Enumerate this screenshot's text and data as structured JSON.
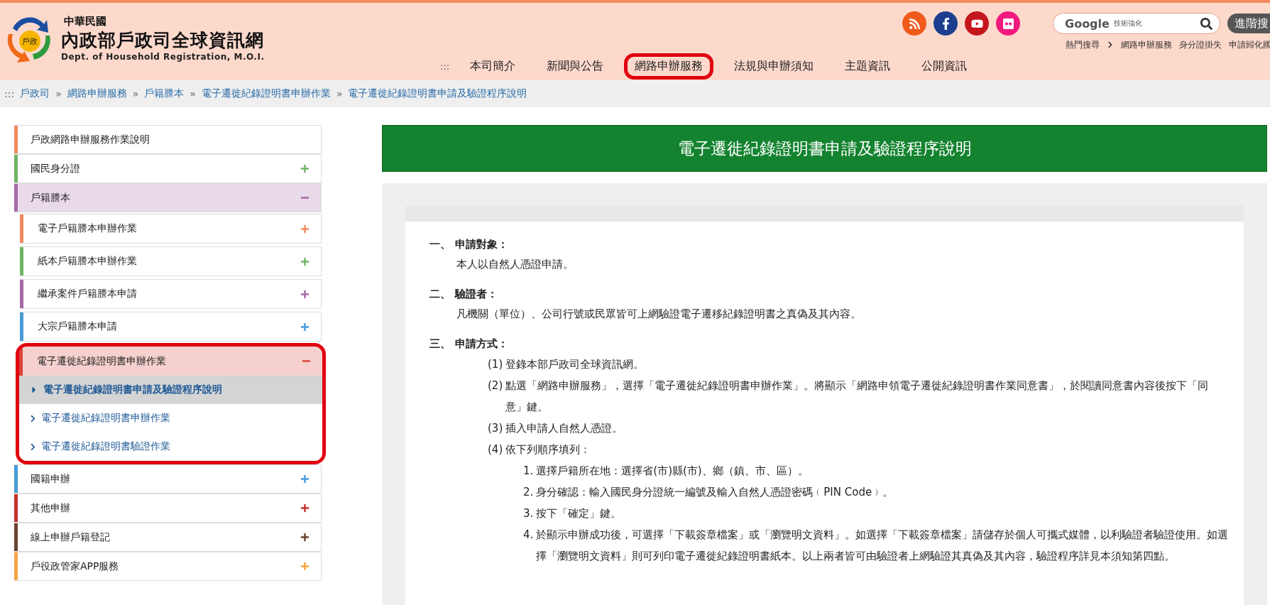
{
  "header": {
    "logo": {
      "center": "戶政"
    },
    "country": "中華民國",
    "site_title": "內政部戶政司全球資訊網",
    "site_subtitle": "Dept. of Household Registration, M.O.I.",
    "social": [
      {
        "kind": "rss",
        "color": "#f05a1a"
      },
      {
        "kind": "facebook",
        "color": "#1d3d8f"
      },
      {
        "kind": "youtube",
        "color": "#c4161c"
      },
      {
        "kind": "flickr",
        "color": "#f0197d"
      }
    ],
    "search": {
      "brand": "Google",
      "brand_note": "技術強化",
      "button": "進階搜"
    },
    "hot_search": {
      "label": "熱門搜尋",
      "links": [
        "網路申辦服務",
        "身分證掛失",
        "申請歸化國"
      ]
    },
    "nav_prefix": ":::",
    "nav": [
      {
        "label": "本司簡介",
        "annotated": false
      },
      {
        "label": "新聞與公告",
        "annotated": false
      },
      {
        "label": "網路申辦服務",
        "annotated": true
      },
      {
        "label": "法規與申辦須知",
        "annotated": false
      },
      {
        "label": "主題資訊",
        "annotated": false
      },
      {
        "label": "公開資訊",
        "annotated": false
      }
    ]
  },
  "breadcrumb": {
    "prefix": ":::",
    "separator": "»",
    "items": [
      "戶政司",
      "網路申辦服務",
      "戶籍謄本",
      "電子遷徙紀錄證明書申辦作業",
      "電子遷徙紀錄證明書申請及驗證程序說明"
    ]
  },
  "sidebar": [
    {
      "label": "戶政網路申辦服務作業說明",
      "color": "#f08a5d",
      "kind": "plain"
    },
    {
      "label": "國民身分證",
      "color": "#6fb464",
      "kind": "group",
      "expanded": false
    },
    {
      "label": "戶籍謄本",
      "color": "#a66aa6",
      "kind": "group",
      "expanded": true,
      "children": [
        {
          "label": "電子戶籍謄本申辦作業",
          "color": "#f08a5d",
          "kind": "group",
          "expanded": false
        },
        {
          "label": "紙本戶籍謄本申辦作業",
          "color": "#6fb464",
          "kind": "group",
          "expanded": false
        },
        {
          "label": "繼承案件戶籍謄本申請",
          "color": "#a66aa6",
          "kind": "group",
          "expanded": false
        },
        {
          "label": "大宗戶籍謄本申請",
          "color": "#4a9ad6",
          "kind": "group",
          "expanded": false
        },
        {
          "label": "電子遷徙紀錄證明書申辦作業",
          "color": "#d9453a",
          "kind": "group",
          "expanded": true,
          "annotated": true,
          "children": [
            {
              "label": "電子遷徙紀錄證明書申請及驗證程序說明",
              "selected": true
            },
            {
              "label": "電子遷徙紀錄證明書申辦作業",
              "selected": false
            },
            {
              "label": "電子遷徙紀錄證明書驗證作業",
              "selected": false
            }
          ]
        }
      ]
    },
    {
      "label": "國籍申辦",
      "color": "#4a9ad6",
      "kind": "group",
      "expanded": false
    },
    {
      "label": "其他申辦",
      "color": "#c7302b",
      "kind": "group",
      "expanded": false
    },
    {
      "label": "線上申辦戶籍登記",
      "color": "#6b4330",
      "kind": "group",
      "expanded": false
    },
    {
      "label": "戶役政管家APP服務",
      "color": "#f5a442",
      "kind": "group",
      "expanded": false
    }
  ],
  "page_title": "電子遷徙紀錄證明書申請及驗證程序說明",
  "sections": [
    {
      "number": "一、",
      "title": "申請對象：",
      "body": "本人以自然人憑證申請。"
    },
    {
      "number": "二、",
      "title": "驗證者：",
      "body": "凡機關（單位）、公司行號或民眾皆可上網驗證電子遷移紀錄證明書之真偽及其內容。"
    },
    {
      "number": "三、",
      "title": "申請方式：",
      "steps": [
        {
          "marker": "(1)",
          "text": "登錄本部戶政司全球資訊網。"
        },
        {
          "marker": "(2)",
          "text": "點選「網路申辦服務」，選擇「電子遷徙紀錄證明書申辦作業」。將顯示「網路申領電子遷徙紀錄證明書作業同意書」，於閱讀同意書內容後按下「同意」鍵。"
        },
        {
          "marker": "(3)",
          "text": "插入申請人自然人憑證。"
        },
        {
          "marker": "(4)",
          "text": "依下列順序填列：",
          "children": [
            {
              "marker": "1.",
              "text": "選擇戶籍所在地：選擇省(市)縣(市)、鄉（鎮、市、區）。"
            },
            {
              "marker": "2.",
              "text": "身分確認：輸入國民身分證統一編號及輸入自然人憑證密碼﹙PIN Code﹚。"
            },
            {
              "marker": "3.",
              "text": "按下「確定」鍵。"
            },
            {
              "marker": "4.",
              "text": "於顯示申辦成功後，可選擇「下載簽章檔案」或「瀏覽明文資料」。如選擇「下載簽章檔案」請儲存於個人可攜式媒體，以利驗證者驗證使用。如選擇「瀏覽明文資料」則可列印電子遷徙紀錄證明書紙本。以上兩者皆可由驗證者上網驗證其真偽及其內容，驗證程序詳見本須知第四點。"
            }
          ]
        }
      ]
    }
  ]
}
